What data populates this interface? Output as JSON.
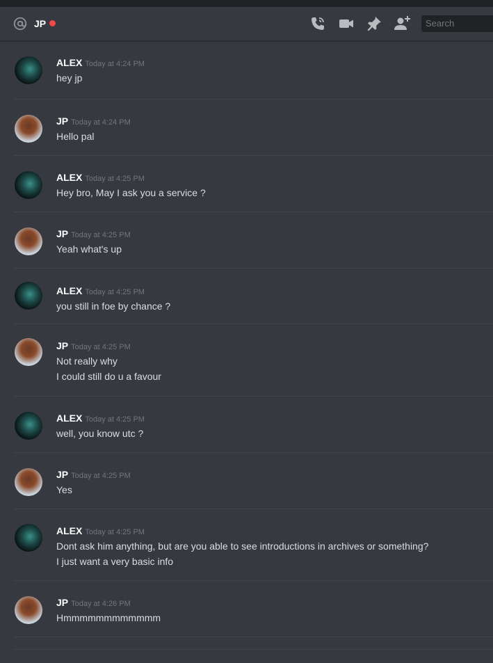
{
  "header": {
    "channel_name": "JP",
    "status_color": "#f04747",
    "icons": [
      "at-icon",
      "phone-call-icon",
      "video-call-icon",
      "pin-icon",
      "add-friend-icon"
    ],
    "search_placeholder": "Search"
  },
  "messages": [
    {
      "author": "ALEX",
      "timestamp": "Today at 4:24 PM",
      "lines": [
        "hey jp"
      ]
    },
    {
      "author": "JP",
      "timestamp": "Today at 4:24 PM",
      "lines": [
        "Hello pal"
      ]
    },
    {
      "author": "ALEX",
      "timestamp": "Today at 4:25 PM",
      "lines": [
        "Hey bro, May I ask you a service ?"
      ]
    },
    {
      "author": "JP",
      "timestamp": "Today at 4:25 PM",
      "lines": [
        "Yeah what's up"
      ]
    },
    {
      "author": "ALEX",
      "timestamp": "Today at 4:25 PM",
      "lines": [
        "you still in foe by chance ?"
      ]
    },
    {
      "author": "JP",
      "timestamp": "Today at 4:25 PM",
      "lines": [
        "Not really why",
        "I could still do u a favour"
      ]
    },
    {
      "author": "ALEX",
      "timestamp": "Today at 4:25 PM",
      "lines": [
        "well, you know utc ?"
      ]
    },
    {
      "author": "JP",
      "timestamp": "Today at 4:25 PM",
      "lines": [
        "Yes"
      ]
    },
    {
      "author": "ALEX",
      "timestamp": "Today at 4:25 PM",
      "lines": [
        "Dont ask him anything, but are you able to see introductions in archives or something?",
        "I just want a very basic info"
      ]
    },
    {
      "author": "JP",
      "timestamp": "Today at 4:26 PM",
      "lines": [
        "Hmmmmmmmmmmmm"
      ]
    }
  ]
}
